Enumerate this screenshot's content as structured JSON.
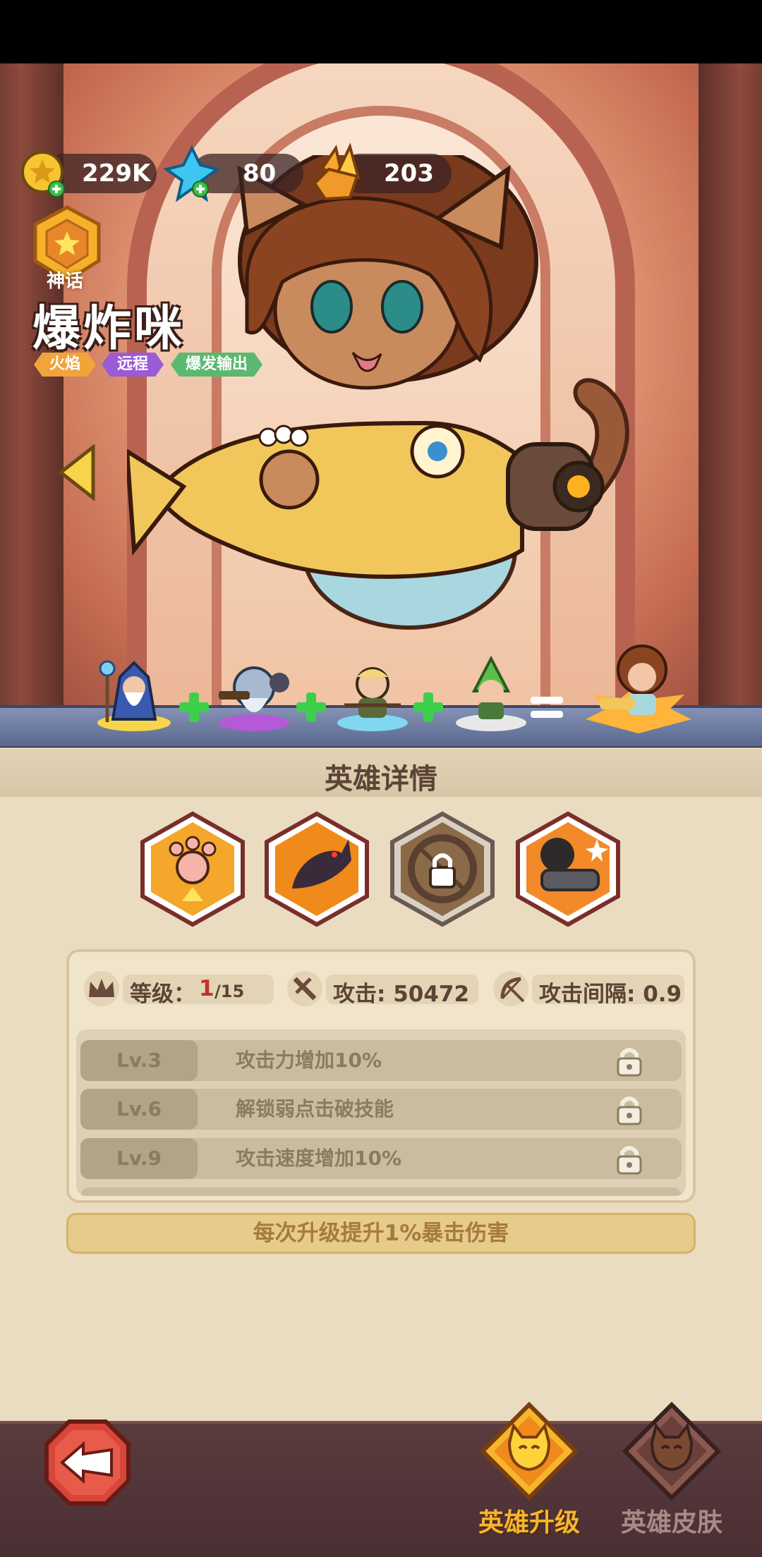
{
  "resources": {
    "gold": "229K",
    "gems": "80",
    "crystals": "203"
  },
  "hero": {
    "rarity": "神话",
    "name": "爆炸咪",
    "tags": [
      {
        "label": "火焰",
        "color": "#f0a43a"
      },
      {
        "label": "远程",
        "color": "#9b5ad6"
      },
      {
        "label": "爆发输出",
        "color": "#5bb870"
      }
    ]
  },
  "details": {
    "title": "英雄详情",
    "skills": [
      {
        "icon": "paw-upgrade-icon",
        "locked": false
      },
      {
        "icon": "cat-dash-icon",
        "locked": false
      },
      {
        "icon": "bow-skill-icon",
        "locked": true
      },
      {
        "icon": "cat-gatling-icon",
        "locked": false
      }
    ],
    "stats": {
      "level_label": "等级：",
      "level_current": "1",
      "level_max": "/15",
      "attack": "攻击: 50472",
      "interval": "攻击间隔: 0.9"
    },
    "level_unlocks": [
      {
        "level": "Lv.3",
        "desc": "攻击力增加10%"
      },
      {
        "level": "Lv.6",
        "desc": "解锁弱点击破技能"
      },
      {
        "level": "Lv.9",
        "desc": "攻击速度增加10%"
      }
    ],
    "upgrade_bonus": "每次升级提升1%暴击伤害"
  },
  "nav": {
    "upgrade": "英雄升级",
    "skins": "英雄皮肤"
  },
  "colors": {
    "active_tab": "#f7b52c",
    "inactive_tab": "#a98a86"
  }
}
